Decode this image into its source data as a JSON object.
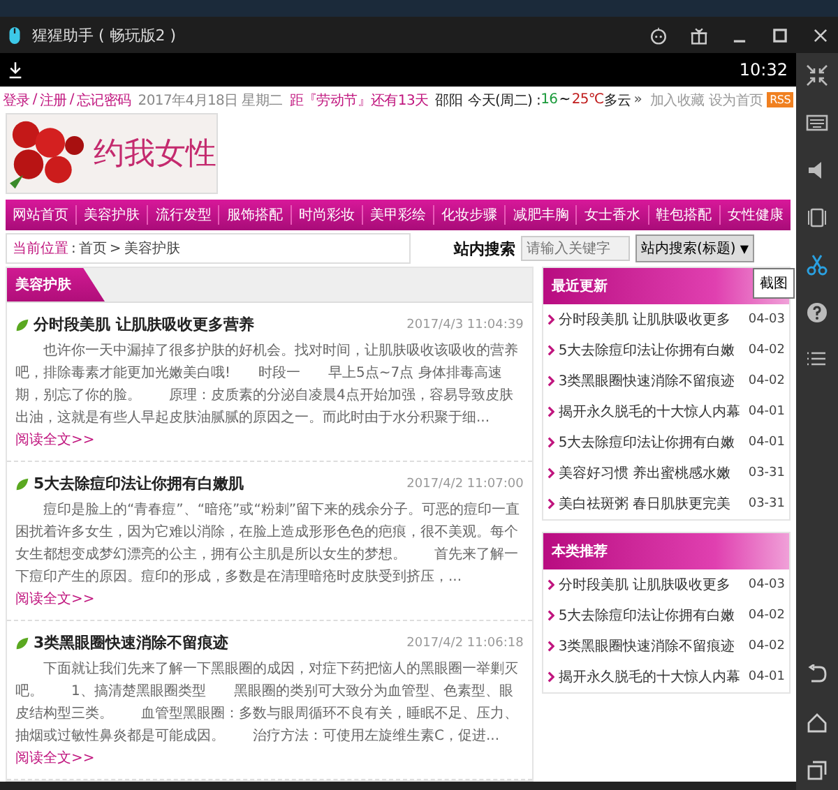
{
  "window": {
    "title": "猩猩助手 ( 畅玩版2 )"
  },
  "status_bar": {
    "time": "10:32"
  },
  "top_bar": {
    "links": [
      "登录",
      "注册",
      "忘记密码"
    ],
    "link_separator": "/",
    "date": "2017年4月18日 星期二",
    "countdown": "距『劳动节』还有13天",
    "city": "邵阳",
    "weather_day": "今天(周二) :",
    "temp_low": "16",
    "temp_sep": "~",
    "temp_high": "25℃",
    "weather": "多云",
    "more": "»",
    "actions": [
      "加入收藏",
      "设为首页"
    ],
    "rss": "RSS"
  },
  "logo": {
    "text": "约我女性"
  },
  "nav": [
    "网站首页",
    "美容护肤",
    "流行发型",
    "服饰搭配",
    "时尚彩妆",
    "美甲彩绘",
    "化妆步骤",
    "减肥丰胸",
    "女士香水",
    "鞋包搭配",
    "女性健康"
  ],
  "breadcrumb": {
    "label": "当前位置",
    "separator": ":",
    "path": [
      "首页",
      "美容护肤"
    ],
    "path_separator": ">"
  },
  "search": {
    "label": "站内搜索",
    "placeholder": "请输入关键字",
    "scope": "站内搜索(标题)",
    "caret": "▼"
  },
  "tooltip": "截图",
  "main": {
    "title": "美容护肤",
    "articles": [
      {
        "title": "分时段美肌 让肌肤吸收更多营养",
        "date": "2017/4/3 11:04:39",
        "summary": "也许你一天中漏掉了很多护肤的好机会。找对时间，让肌肤吸收该吸收的营养吧，排除毒素才能更加光嫩美白哦!　　时段一　　早上5点~7点 身体排毒高速期，别忘了你的脸。　　原理：皮质素的分泌自凌晨4点开始加强，容易导致皮肤出油，这就是有些人早起皮肤油腻腻的原因之一。而此时由于水分积聚于细...",
        "more": "阅读全文>>"
      },
      {
        "title": "5大去除痘印法让你拥有白嫩肌",
        "date": "2017/4/2 11:07:00",
        "summary": "痘印是脸上的“青春痘”、“暗疮”或“粉刺”留下来的残余分子。可恶的痘印一直困扰着许多女生，因为它难以消除，在脸上造成形形色色的疤痕，很不美观。每个女生都想变成梦幻漂亮的公主，拥有公主肌是所以女生的梦想。　　首先来了解一下痘印产生的原因。痘印的形成，多数是在清理暗疮时皮肤受到挤压，...",
        "more": "阅读全文>>"
      },
      {
        "title": "3类黑眼圈快速消除不留痕迹",
        "date": "2017/4/2 11:06:18",
        "summary": "下面就让我们先来了解一下黑眼圈的成因，对症下药把恼人的黑眼圈一举剿灭吧。　　1、搞清楚黑眼圈类型　　黑眼圈的类别可大致分为血管型、色素型、眼皮结构型三类。　　血管型黑眼圈：多数与眼周循环不良有关，睡眠不足、压力、抽烟或过敏性鼻炎都是可能成因。　　治疗方法：可使用左旋维生素C，促进...",
        "more": "阅读全文>>"
      }
    ]
  },
  "side_panels": [
    {
      "title": "最近更新",
      "items": [
        {
          "title": "分时段美肌 让肌肤吸收更多",
          "date": "04-03"
        },
        {
          "title": "5大去除痘印法让你拥有白嫩",
          "date": "04-02"
        },
        {
          "title": "3类黑眼圈快速消除不留痕迹",
          "date": "04-02"
        },
        {
          "title": "揭开永久脱毛的十大惊人内幕",
          "date": "04-01"
        },
        {
          "title": "5大去除痘印法让你拥有白嫩",
          "date": "04-01"
        },
        {
          "title": "美容好习惯 养出蜜桃感水嫩",
          "date": "03-31"
        },
        {
          "title": "美白祛斑粥 春日肌肤更完美",
          "date": "03-31"
        }
      ]
    },
    {
      "title": "本类推荐",
      "items": [
        {
          "title": "分时段美肌 让肌肤吸收更多",
          "date": "04-03"
        },
        {
          "title": "5大去除痘印法让你拥有白嫩",
          "date": "04-02"
        },
        {
          "title": "3类黑眼圈快速消除不留痕迹",
          "date": "04-02"
        },
        {
          "title": "揭开永久脱毛的十大惊人内幕",
          "date": "04-01"
        }
      ]
    }
  ]
}
